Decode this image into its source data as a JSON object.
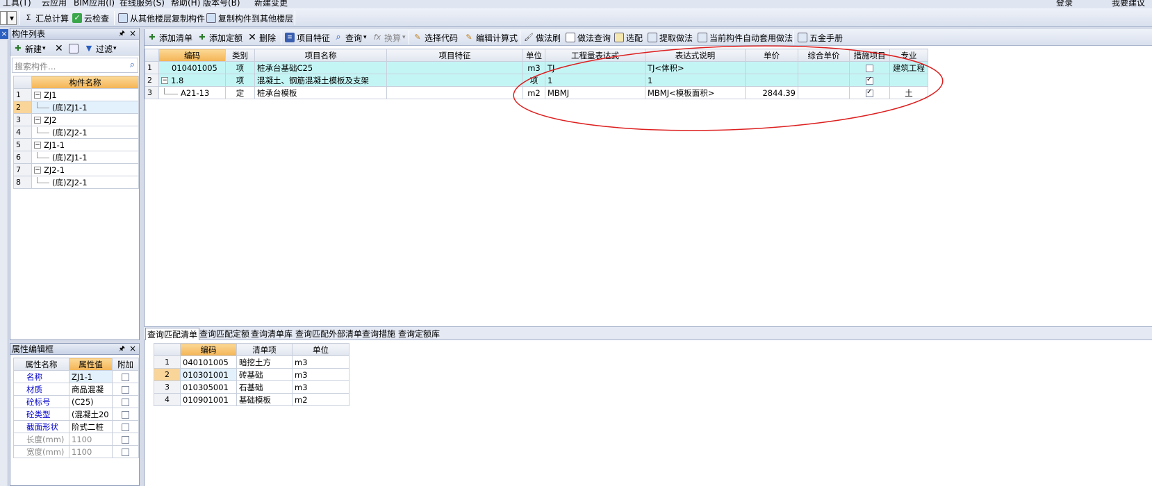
{
  "menubar": {
    "items": [
      "工具(T)",
      "云应用",
      "BIM应用(I)",
      "在线服务(S)",
      "帮助(H)",
      "版本号(B)",
      "新建变更"
    ],
    "right_items": [
      "登录",
      "我要建议"
    ]
  },
  "toolbar1": {
    "sum_calc": "汇总计算",
    "cloud_check": "云检查",
    "copy_from_floors": "从其他楼层复制构件",
    "copy_to_floors": "复制构件到其他楼层"
  },
  "component_list": {
    "title": "构件列表",
    "new_label": "新建",
    "filter_label": "过滤",
    "search_placeholder": "搜索构件...",
    "column_header": "构件名称",
    "rows": [
      {
        "num": "1",
        "name": "ZJ1",
        "level": 0
      },
      {
        "num": "2",
        "name": "(底)ZJ1-1",
        "level": 1
      },
      {
        "num": "3",
        "name": "ZJ2",
        "level": 0
      },
      {
        "num": "4",
        "name": "(底)ZJ2-1",
        "level": 1
      },
      {
        "num": "5",
        "name": "ZJ1-1",
        "level": 0
      },
      {
        "num": "6",
        "name": "(底)ZJ1-1",
        "level": 1
      },
      {
        "num": "7",
        "name": "ZJ2-1",
        "level": 0
      },
      {
        "num": "8",
        "name": "(底)ZJ2-1",
        "level": 1
      }
    ]
  },
  "property_editor": {
    "title": "属性编辑框",
    "headers": [
      "属性名称",
      "属性值",
      "附加"
    ],
    "rows": [
      {
        "name": "名称",
        "value": "ZJ1-1",
        "blue": true
      },
      {
        "name": "材质",
        "value": "商品混凝",
        "blue": true
      },
      {
        "name": "砼标号",
        "value": "(C25)",
        "blue": true
      },
      {
        "name": "砼类型",
        "value": "(混凝土20",
        "blue": true
      },
      {
        "name": "截面形状",
        "value": "阶式二桩",
        "blue": true
      },
      {
        "name": "长度(mm)",
        "value": "1100",
        "blue": false
      },
      {
        "name": "宽度(mm)",
        "value": "1100",
        "blue": false
      }
    ]
  },
  "toolbar2": {
    "add_list": "添加清单",
    "add_quota": "添加定额",
    "delete": "删除",
    "item_feature": "项目特征",
    "query": "查询",
    "convert": "换算",
    "select_code": "选择代码",
    "edit_formula": "编辑计算式",
    "method_brush": "做法刷",
    "method_query": "做法查询",
    "select_match": "选配",
    "extract_method": "提取做法",
    "auto_apply": "当前构件自动套用做法",
    "hardware_manual": "五金手册"
  },
  "main_table": {
    "headers": [
      "编码",
      "类别",
      "项目名称",
      "项目特征",
      "单位",
      "工程量表达式",
      "表达式说明",
      "单价",
      "综合单价",
      "措施项目",
      "专业"
    ],
    "rows": [
      {
        "num": "1",
        "code": "010401005",
        "type": "项",
        "name": "桩承台基础C25",
        "feature": "",
        "unit": "m3",
        "expr": "TJ",
        "desc": "TJ<体积>",
        "price": "",
        "total": "",
        "measure": false,
        "major": "建筑工程"
      },
      {
        "num": "2",
        "code": "1.8",
        "type": "项",
        "name": "混凝土、钢筋混凝土模板及支架",
        "feature": "",
        "unit": "项",
        "expr": "1",
        "desc": "1",
        "price": "",
        "total": "",
        "measure": true,
        "major": ""
      },
      {
        "num": "3",
        "code": "A21-13",
        "type": "定",
        "name": "桩承台模板",
        "feature": "",
        "unit": "m2",
        "expr": "MBMJ",
        "desc": "MBMJ<模板面积>",
        "price": "2844.39",
        "total": "",
        "measure": true,
        "major": "土"
      }
    ]
  },
  "query_tabs": [
    "查询匹配清单",
    "查询匹配定额",
    "查询清单库",
    "查询匹配外部清单",
    "查询措施",
    "查询定额库"
  ],
  "query_table": {
    "headers": [
      "编码",
      "清单项",
      "单位"
    ],
    "rows": [
      {
        "num": "1",
        "code": "040101005",
        "item": "暗挖土方",
        "unit": "m3"
      },
      {
        "num": "2",
        "code": "010301001",
        "item": "砖基础",
        "unit": "m3"
      },
      {
        "num": "3",
        "code": "010305001",
        "item": "石基础",
        "unit": "m3"
      },
      {
        "num": "4",
        "code": "010901001",
        "item": "基础模板",
        "unit": "m2"
      }
    ]
  },
  "colors": {
    "annotation_ellipse": "#dd1f1f",
    "row_highlight": "#c4f5f5",
    "active_header": "#f4b454"
  }
}
